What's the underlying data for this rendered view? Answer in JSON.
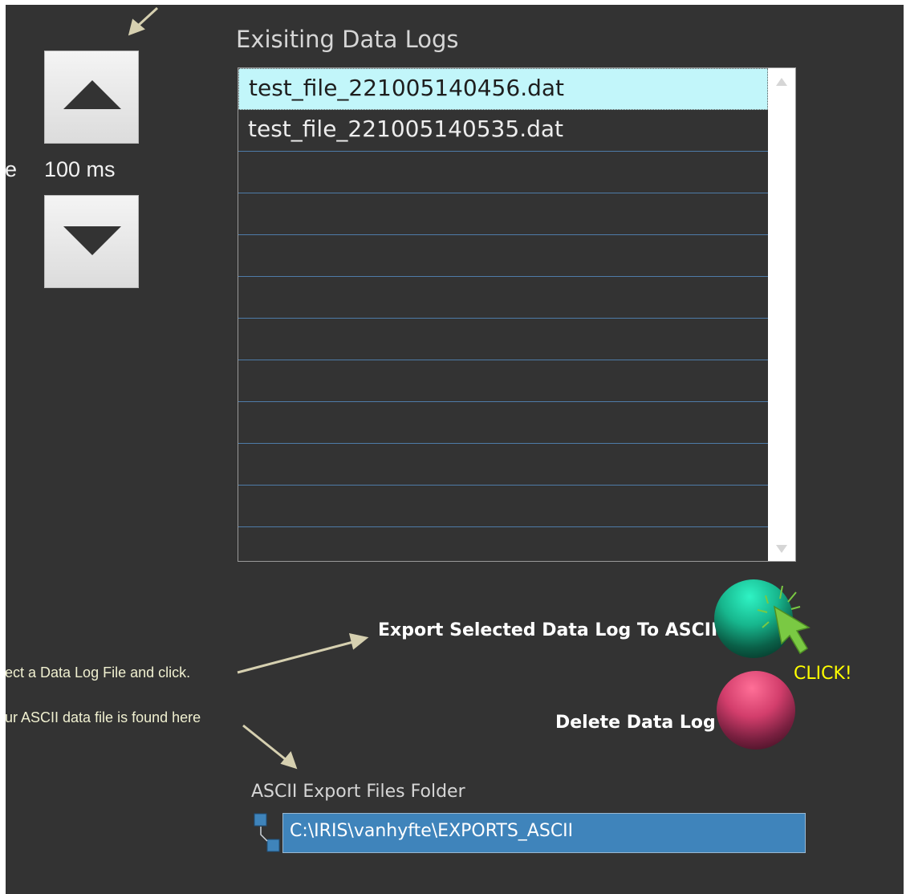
{
  "logging_rate": {
    "label_suffix": "e",
    "value": "100 ms",
    "up_icon": "triangle-up-icon",
    "down_icon": "triangle-down-icon"
  },
  "data_logs": {
    "title": "Exisiting Data Logs",
    "files": [
      "test_file_221005140456.dat",
      "test_file_221005140535.dat"
    ],
    "selected_index": 0,
    "selected_bg": "#c2f6fa",
    "row_separator_color": "#4e7ba8"
  },
  "actions": {
    "export_label": "Export Selected Data Log To ASCII",
    "export_color": "#17b68d",
    "delete_label": "Delete Data Log",
    "delete_color": "#d33e6c",
    "click_callout": "CLICK!",
    "callout_color": "#ffff00",
    "cursor_icon": "green-cursor-arrow-icon",
    "cursor_color": "#7ac943"
  },
  "hints": {
    "select_hint": "ect  a Data Log File and click.",
    "folder_hint": "ur ASCII data file is found here"
  },
  "export_folder": {
    "label": "ASCII Export Files Folder",
    "path": "C:\\IRIS\\vanhyfte\\EXPORTS_ASCII",
    "field_color": "#3f84bb",
    "icon": "folder-tree-icon"
  }
}
